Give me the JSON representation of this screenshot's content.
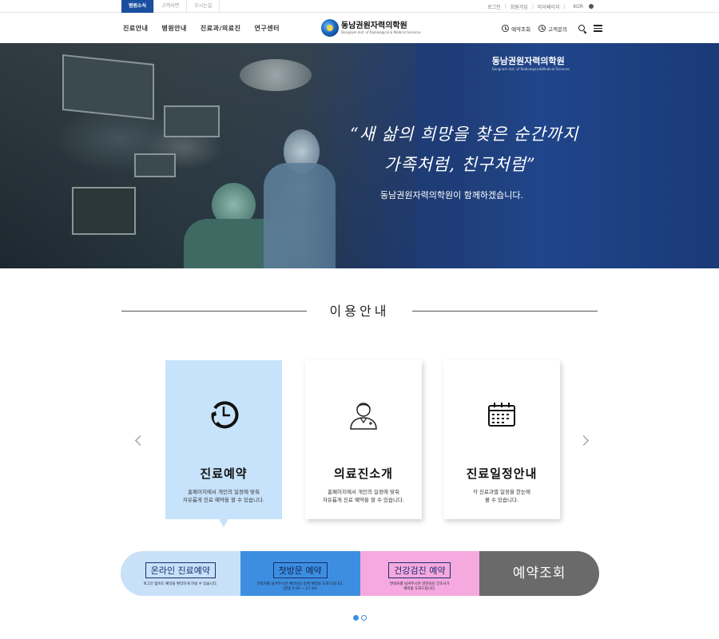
{
  "topbar": {
    "tabs": [
      {
        "label": "병원소식"
      },
      {
        "label": "고객서면"
      },
      {
        "label": "오시는길"
      }
    ],
    "util": {
      "login": "로그인",
      "signup": "회원가입",
      "mypage": "마이페이지",
      "lang": "KOR"
    }
  },
  "header": {
    "menu": [
      {
        "label": "진료안내"
      },
      {
        "label": "병원안내"
      },
      {
        "label": "진료과/의료진"
      },
      {
        "label": "연구센터"
      }
    ],
    "logo": {
      "name": "동남권원자력의학원",
      "sub": "Dongnam Inst. of Radiological & Medical Sciences"
    },
    "links": {
      "reservation_check": "예약조회",
      "customer_inquiry": "고객문의"
    }
  },
  "hero": {
    "brand_name": "동남권원자력의학원",
    "brand_sub": "Dongnam Inst. of Radiological&Medical Sciences",
    "quote_line1": "“새 삶의 희망을 찾은 순간까지",
    "quote_line2": "가족처럼, 친구처럼”",
    "subtitle": "동남권원자력의학원이 함께하겠습니다."
  },
  "usage": {
    "title": "이용안내",
    "cards": [
      {
        "title": "진료예약",
        "desc1": "홈페이지에서 개인의 일정에 맞춰",
        "desc2": "자유롭게 진료 예약을 할 수 있습니다.",
        "icon": "clock-phone-icon"
      },
      {
        "title": "의료진소개",
        "desc1": "홈페이지에서 개인의 일정에 맞춰",
        "desc2": "자유롭게 진료 예약을 할 수 있습니다.",
        "icon": "doctor-icon"
      },
      {
        "title": "진료일정안내",
        "desc1": "각 진료과별 일정을 한눈에",
        "desc2": "볼 수 있습니다.",
        "icon": "calendar-icon"
      }
    ]
  },
  "reservation": {
    "online": {
      "label": "온라인 진료예약",
      "desc": "로그인 없이도 예약을 편리하게 하실 수 있습니다."
    },
    "first_visit": {
      "label": "첫방문 예약",
      "desc1": "연락처를 남겨주시면 예약담당 등에 예약을 도와드립니다.",
      "desc2": "(평일 9:30 ~ 17:30)"
    },
    "checkup": {
      "label": "건강검진 예약",
      "desc1": "연락처를 남겨주시면 검진담당 간호사가",
      "desc2": "예약을 도와드립니다."
    },
    "lookup": {
      "label": "예약조회"
    }
  },
  "colors": {
    "accent": "#1a4fa0",
    "card_active": "#c7e3fb",
    "seg_online": "#c8e1f9",
    "seg_first": "#3d8ee0",
    "seg_checkup": "#f5a9df",
    "seg_lookup": "#6a6a6a"
  }
}
